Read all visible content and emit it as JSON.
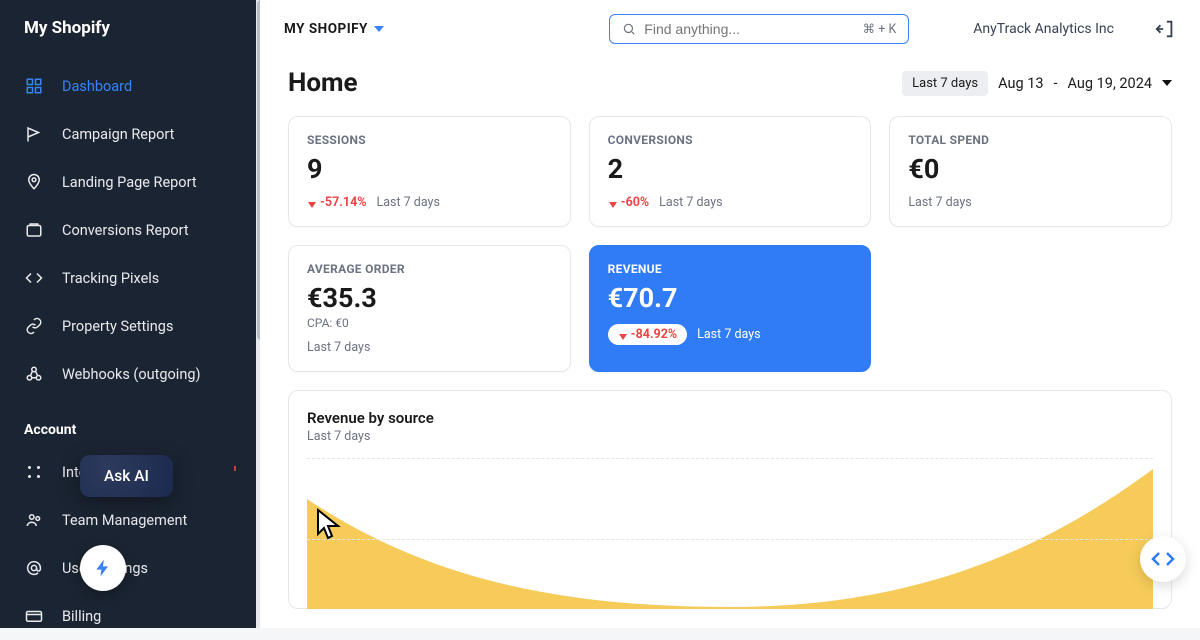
{
  "sidebar": {
    "title": "My Shopify",
    "items": [
      {
        "label": "Dashboard"
      },
      {
        "label": "Campaign Report"
      },
      {
        "label": "Landing Page Report"
      },
      {
        "label": "Conversions Report"
      },
      {
        "label": "Tracking Pixels"
      },
      {
        "label": "Property Settings"
      },
      {
        "label": "Webhooks (outgoing)"
      }
    ],
    "account_heading": "Account",
    "account_items": [
      {
        "label": "Integrations"
      },
      {
        "label": "Team Management"
      },
      {
        "label": "User Settings"
      },
      {
        "label": "Billing"
      }
    ]
  },
  "topbar": {
    "breadcrumb": "MY SHOPIFY",
    "search_placeholder": "Find anything...",
    "search_kbd": "⌘ + K",
    "company": "AnyTrack Analytics Inc"
  },
  "page": {
    "title": "Home",
    "range_pill": "Last 7 days",
    "range_start": "Aug 13",
    "range_sep": "-",
    "range_end": "Aug 19, 2024"
  },
  "cards": {
    "sessions": {
      "label": "SESSIONS",
      "value": "9",
      "delta": "-57.14%",
      "period": "Last 7 days"
    },
    "conversions": {
      "label": "CONVERSIONS",
      "value": "2",
      "delta": "-60%",
      "period": "Last 7 days"
    },
    "spend": {
      "label": "TOTAL SPEND",
      "value": "€0",
      "period": "Last 7 days"
    },
    "avg_order": {
      "label": "AVERAGE ORDER",
      "value": "€35.3",
      "sub": "CPA: €0",
      "period": "Last 7 days"
    },
    "revenue": {
      "label": "REVENUE",
      "value": "€70.7",
      "delta": "-84.92%",
      "period": "Last 7 days"
    }
  },
  "chart": {
    "title": "Revenue by source",
    "sub": "Last 7 days"
  },
  "ask_ai": "Ask AI",
  "chart_data": {
    "type": "area",
    "title": "Revenue by source",
    "sub": "Last 7 days",
    "series": [
      {
        "name": "revenue",
        "values": [
          70,
          20,
          5,
          2,
          5,
          30,
          85
        ]
      }
    ],
    "ylim": [
      0,
      100
    ]
  }
}
